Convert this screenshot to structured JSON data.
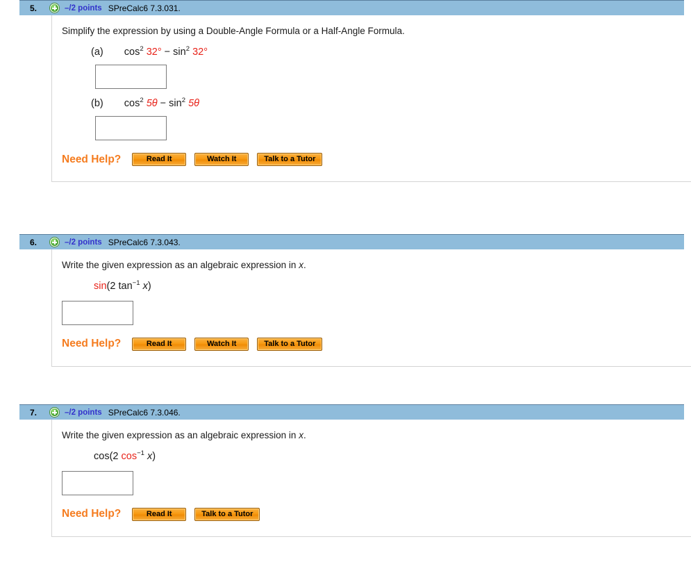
{
  "theme": {
    "header_bg": "#8fbcdb",
    "header_border": "#5b7f9e",
    "points_color": "#3333cc",
    "needhelp_color": "#f57c1f",
    "button_orange": "#f79a12",
    "math_red": "#e8231a",
    "panel_border": "#d4d4d4",
    "input_border": "#7a7a7a"
  },
  "icons": {
    "expand_plus": "plus-circle-icon"
  },
  "problems": [
    {
      "number": "5.",
      "points": "–/2 points",
      "qref": "SPreCalc6 7.3.031.",
      "statement": "Simplify the expression by using a Double-Angle Formula or a Half-Angle Formula.",
      "parts": [
        {
          "label": "(a)",
          "expr_plain": "cos^2 32° − sin^2 32°",
          "tokens": [
            {
              "text": "cos",
              "color": "black",
              "sup": "2",
              "sup_color": "black"
            },
            {
              "text": "32°",
              "color": "red",
              "space_before": true
            },
            {
              "text": "−",
              "color": "black",
              "space_before": true
            },
            {
              "text": "sin",
              "color": "black",
              "sup": "2",
              "sup_color": "black",
              "space_before": true
            },
            {
              "text": "32°",
              "color": "red",
              "space_before": true
            }
          ],
          "answer_value": "",
          "answer_placeholder": ""
        },
        {
          "label": "(b)",
          "expr_plain": "cos^2 5θ − sin^2 5θ",
          "tokens": [
            {
              "text": "cos",
              "color": "black",
              "sup": "2",
              "sup_color": "black"
            },
            {
              "text": "5θ",
              "color": "red",
              "italic": true,
              "space_before": true
            },
            {
              "text": "−",
              "color": "black",
              "space_before": true
            },
            {
              "text": "sin",
              "color": "black",
              "sup": "2",
              "sup_color": "black",
              "space_before": true
            },
            {
              "text": "5θ",
              "color": "red",
              "italic": true,
              "space_before": true
            }
          ],
          "answer_value": "",
          "answer_placeholder": ""
        }
      ],
      "need_help_label": "Need Help?",
      "help_buttons": [
        "Read It",
        "Watch It",
        "Talk to a Tutor"
      ]
    },
    {
      "number": "6.",
      "points": "–/2 points",
      "qref": "SPreCalc6 7.3.043.",
      "statement": "Write the given expression as an algebraic expression in x.",
      "parts": [
        {
          "label": "",
          "expr_plain": "sin(2 tan^-1 x)",
          "tokens": [
            {
              "text": "sin",
              "color": "red"
            },
            {
              "text": "(2",
              "color": "black"
            },
            {
              "text": "tan",
              "color": "black",
              "sup": "−1",
              "sup_color": "black",
              "space_before": true
            },
            {
              "text": "x",
              "color": "black",
              "italic": true,
              "space_before": true
            },
            {
              "text": ")",
              "color": "black"
            }
          ],
          "answer_value": "",
          "answer_placeholder": ""
        }
      ],
      "need_help_label": "Need Help?",
      "help_buttons": [
        "Read It",
        "Watch It",
        "Talk to a Tutor"
      ]
    },
    {
      "number": "7.",
      "points": "–/2 points",
      "qref": "SPreCalc6 7.3.046.",
      "statement": "Write the given expression as an algebraic expression in x.",
      "parts": [
        {
          "label": "",
          "expr_plain": "cos(2 cos^-1 x)",
          "tokens": [
            {
              "text": "cos(2",
              "color": "black"
            },
            {
              "text": "cos",
              "color": "red",
              "sup": "−1",
              "sup_color": "black",
              "space_before": true
            },
            {
              "text": "x",
              "color": "black",
              "italic": true,
              "space_before": true
            },
            {
              "text": ")",
              "color": "black"
            }
          ],
          "answer_value": "",
          "answer_placeholder": ""
        }
      ],
      "need_help_label": "Need Help?",
      "help_buttons": [
        "Read It",
        "Talk to a Tutor"
      ]
    }
  ]
}
